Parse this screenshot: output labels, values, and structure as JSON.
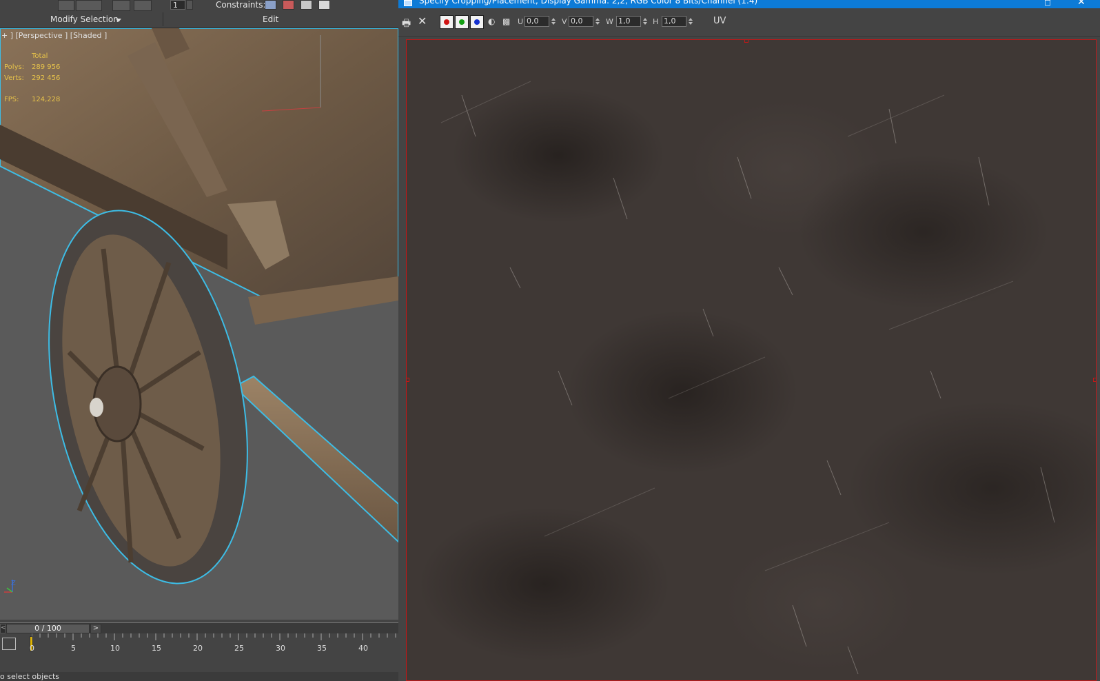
{
  "left_panel": {
    "toolbar": {
      "spinner_value": "1",
      "constraints_label": "Constraints:",
      "sections": {
        "modify_selection": "Modify Selection",
        "edit": "Edit"
      }
    },
    "viewport": {
      "label": "+ ] [Perspective ] [Shaded ]",
      "stats": {
        "total_header": "Total",
        "polys_label": "Polys:",
        "polys_value": "289 956",
        "verts_label": "Verts:",
        "verts_value": "292 456",
        "fps_label": "FPS:",
        "fps_value": "124,228"
      },
      "axis_z": "Z"
    },
    "time_slider": {
      "value": "0 / 100",
      "left_arrow": "<",
      "right_arrow": ">"
    },
    "trackbar": {
      "ticks": [
        "0",
        "5",
        "10",
        "15",
        "20",
        "25",
        "30",
        "35",
        "40"
      ]
    },
    "status_text": "o select objects"
  },
  "crop_window": {
    "title": "Specify Cropping/Placement, Display Gamma: 2,2, RGB Color 8 Bits/Channel (1:4)",
    "maximize_glyph": "☐",
    "close_glyph": "✕",
    "toolbar": {
      "fields": [
        {
          "label": "U",
          "value": "0,0"
        },
        {
          "label": "V",
          "value": "0,0"
        },
        {
          "label": "W",
          "value": "1,0"
        },
        {
          "label": "H",
          "value": "1,0"
        }
      ],
      "uv_toggle": "UV",
      "channel_colors": [
        "#d01414",
        "#14a014",
        "#1430d0"
      ]
    },
    "image_content": "dark scratched metal texture"
  }
}
